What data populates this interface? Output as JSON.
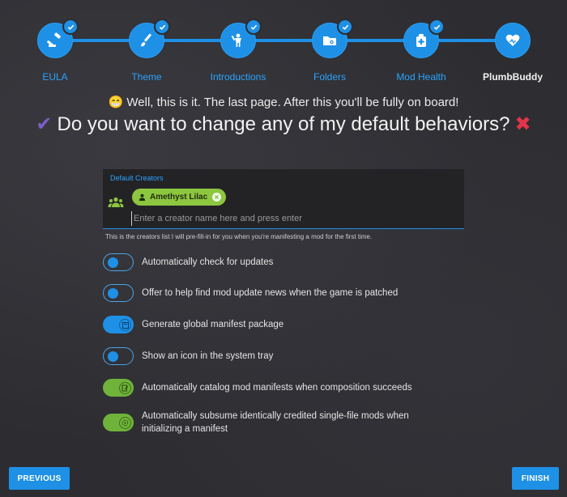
{
  "steps": [
    {
      "label": "EULA",
      "icon": "gavel-icon",
      "done": true
    },
    {
      "label": "Theme",
      "icon": "paint-brush-icon",
      "done": true
    },
    {
      "label": "Introductions",
      "icon": "person-icon",
      "done": true
    },
    {
      "label": "Folders",
      "icon": "folder-icon",
      "done": true
    },
    {
      "label": "Mod Health",
      "icon": "medical-icon",
      "done": true
    },
    {
      "label": "PlumbBuddy",
      "icon": "heart-icon",
      "done": false,
      "current": true
    }
  ],
  "intro": {
    "emoji": "😁",
    "subheading": "Well, this is it. The last page. After this you'll be fully on board!",
    "heading": "Do you want to change any of my default behaviors?",
    "check_glyph": "✔",
    "cross_glyph": "✖"
  },
  "creators": {
    "label": "Default Creators",
    "chips": [
      "Amethyst Lilac"
    ],
    "placeholder": "Enter a creator name here and press enter",
    "hint": "This is the creators list I will pre-fill-in for you when you're manifesting a mod for the first time."
  },
  "toggles": [
    {
      "label": "Automatically check for updates",
      "state": "off"
    },
    {
      "label": "Offer to help find mod update news when the game is patched",
      "state": "off"
    },
    {
      "label": "Generate global manifest package",
      "state": "on-blue"
    },
    {
      "label": "Show an icon in the system tray",
      "state": "off"
    },
    {
      "label": "Automatically catalog mod manifests when composition succeeds",
      "state": "on-green"
    },
    {
      "label": "Automatically subsume identically credited single-file mods when initializing a manifest",
      "state": "on-green"
    }
  ],
  "buttons": {
    "previous": "PREVIOUS",
    "finish": "FINISH"
  },
  "colors": {
    "accent": "#1e90e6",
    "chip": "#8dc63f",
    "green_toggle": "#6fb33a",
    "check": "#7b5fc7",
    "cross": "#e3344a"
  }
}
